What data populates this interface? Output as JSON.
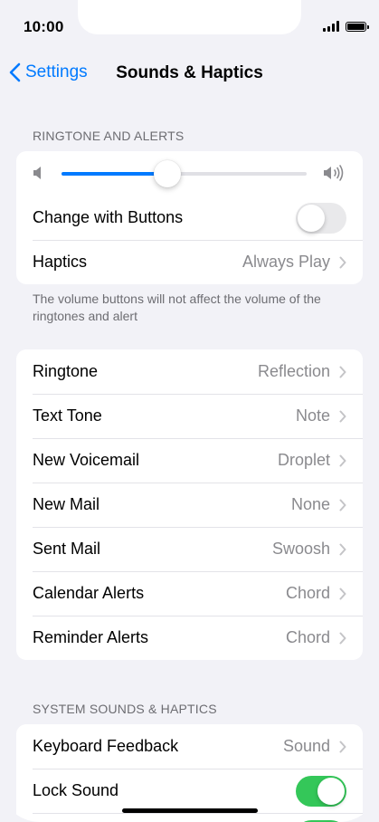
{
  "status_bar": {
    "time": "10:00"
  },
  "navbar": {
    "back_label": "Settings",
    "title": "Sounds & Haptics"
  },
  "ringtone_alerts": {
    "header": "RINGTONE AND ALERTS",
    "volume_level": 0.43,
    "change_with_buttons": {
      "label": "Change with Buttons",
      "enabled": false
    },
    "haptics": {
      "label": "Haptics",
      "value": "Always Play"
    },
    "footnote": "The volume buttons will not affect the volume of the ringtones and alert"
  },
  "tones": {
    "rows": [
      {
        "label": "Ringtone",
        "value": "Reflection"
      },
      {
        "label": "Text Tone",
        "value": "Note"
      },
      {
        "label": "New Voicemail",
        "value": "Droplet"
      },
      {
        "label": "New Mail",
        "value": "None"
      },
      {
        "label": "Sent Mail",
        "value": "Swoosh"
      },
      {
        "label": "Calendar Alerts",
        "value": "Chord"
      },
      {
        "label": "Reminder Alerts",
        "value": "Chord"
      }
    ]
  },
  "system": {
    "header": "SYSTEM SOUNDS & HAPTICS",
    "keyboard_feedback": {
      "label": "Keyboard Feedback",
      "value": "Sound"
    },
    "lock_sound": {
      "label": "Lock Sound",
      "enabled": true
    }
  },
  "colors": {
    "accent": "#007aff",
    "toggle_on": "#34c759",
    "background": "#f2f2f7"
  },
  "icons": [
    "back-chevron-icon",
    "volume-low-icon",
    "volume-high-icon",
    "chevron-right-icon",
    "signal-icon",
    "battery-icon"
  ]
}
